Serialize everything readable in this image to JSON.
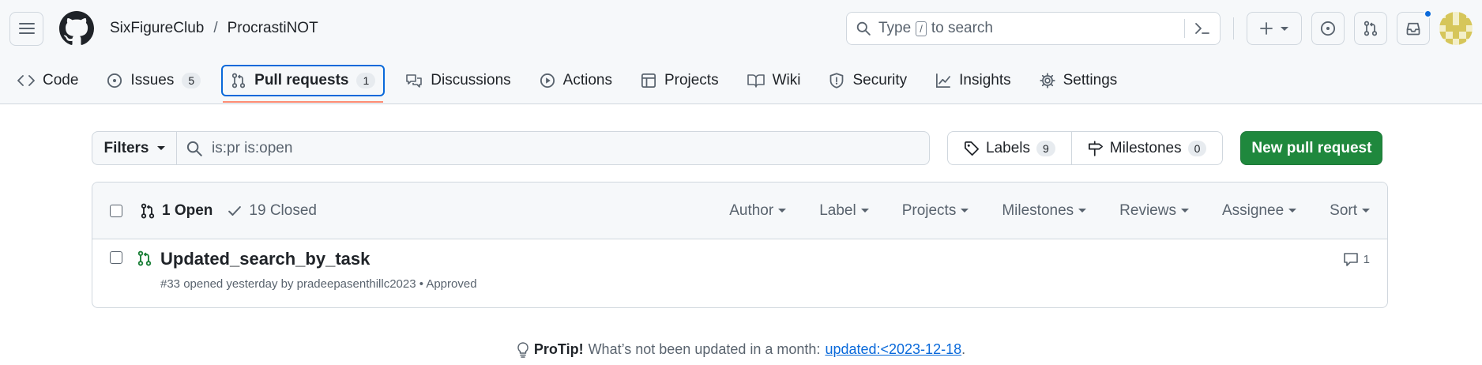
{
  "header": {
    "owner": "SixFigureClub",
    "separator": "/",
    "repo": "ProcrastiNOT",
    "search_prefix": "Type",
    "search_key": "/",
    "search_suffix": "to search"
  },
  "tabs": [
    {
      "label": "Code",
      "icon": "code-icon"
    },
    {
      "label": "Issues",
      "icon": "issue-icon",
      "count": "5"
    },
    {
      "label": "Pull requests",
      "icon": "pull-request-icon",
      "count": "1",
      "selected": true
    },
    {
      "label": "Discussions",
      "icon": "discussions-icon"
    },
    {
      "label": "Actions",
      "icon": "play-icon"
    },
    {
      "label": "Projects",
      "icon": "table-icon"
    },
    {
      "label": "Wiki",
      "icon": "book-icon"
    },
    {
      "label": "Security",
      "icon": "shield-icon"
    },
    {
      "label": "Insights",
      "icon": "graph-icon"
    },
    {
      "label": "Settings",
      "icon": "gear-icon"
    }
  ],
  "toolbar": {
    "filters_label": "Filters",
    "filter_query": "is:pr is:open",
    "labels_label": "Labels",
    "labels_count": "9",
    "milestones_label": "Milestones",
    "milestones_count": "0",
    "new_pr_label": "New pull request"
  },
  "list": {
    "open_label": "1 Open",
    "closed_label": "19 Closed",
    "filters": [
      "Author",
      "Label",
      "Projects",
      "Milestones",
      "Reviews",
      "Assignee",
      "Sort"
    ],
    "items": [
      {
        "title": "Updated_search_by_task",
        "meta": "#33 opened yesterday by pradeepasenthillc2023 • Approved",
        "comments": "1"
      }
    ]
  },
  "protip": {
    "strong": "ProTip!",
    "text": "What’s not been updated in a month:",
    "link": "updated:<2023-12-18",
    "end": "."
  },
  "colors": {
    "accent": "#0969da",
    "primary_button": "#1f883d",
    "open_state": "#1a7f37",
    "tab_underline": "#fd8c73"
  }
}
